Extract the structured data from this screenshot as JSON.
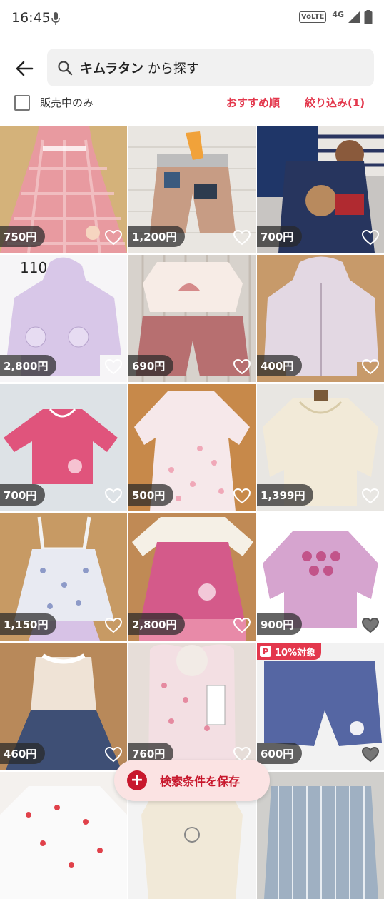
{
  "status_bar": {
    "time": "16:45",
    "volte": "VoLTE",
    "network": "4G"
  },
  "search": {
    "keyword": "キムラタン",
    "suffix": " から探す"
  },
  "filters": {
    "on_sale_label": "販売中のみ",
    "sort_label": "おすすめ順",
    "filter_label": "絞り込み(1)"
  },
  "items": [
    {
      "price": "750円",
      "image": "pink-plaid-dress"
    },
    {
      "price": "1,200円",
      "image": "beige-shorts"
    },
    {
      "price": "700円",
      "image": "navy-bear-set"
    },
    {
      "price": "2,800円",
      "image": "lavender-hooded-jacket",
      "size_label": "110"
    },
    {
      "price": "690円",
      "image": "top-and-pink-shorts"
    },
    {
      "price": "400円",
      "image": "lavender-jacket"
    },
    {
      "price": "700円",
      "image": "pink-long-sleeve-top"
    },
    {
      "price": "500円",
      "image": "floral-tunic"
    },
    {
      "price": "1,399円",
      "image": "cream-cardigan"
    },
    {
      "price": "1,150円",
      "image": "floral-jumper-skirt"
    },
    {
      "price": "2,800円",
      "image": "pink-dress"
    },
    {
      "price": "900円",
      "image": "pink-sweatshirt"
    },
    {
      "price": "460円",
      "image": "floral-denim-dress"
    },
    {
      "price": "760円",
      "image": "floral-bib"
    },
    {
      "price": "600円",
      "image": "blue-pants",
      "promo": "10%対象"
    },
    {
      "price": "",
      "image": "tulip-shirt"
    },
    {
      "price": "",
      "image": "cream-top"
    },
    {
      "price": "",
      "image": "striped-overalls"
    }
  ],
  "save_search": {
    "label": "検索条件を保存"
  },
  "colors": {
    "accent": "#e3374c",
    "save_text": "#c8182d",
    "save_bg": "#fbe3e3"
  }
}
